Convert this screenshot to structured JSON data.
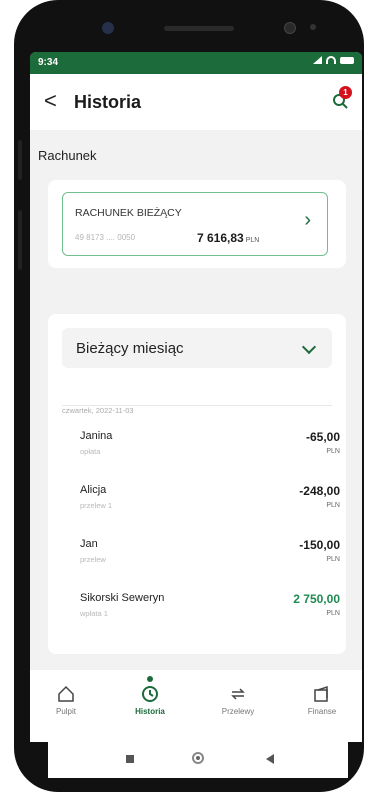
{
  "status": {
    "time": "9:34"
  },
  "header": {
    "title": "Historia",
    "back_label": "<",
    "notification_count": "1"
  },
  "section": {
    "label": "Rachunek"
  },
  "account": {
    "name": "RACHUNEK BIEŻĄCY",
    "number": "49 8173 .... 0050",
    "balance": "7 616,83",
    "currency": "PLN"
  },
  "period": {
    "selected": "Bieżący miesiąc"
  },
  "history": {
    "date": "czwartek, 2022-11-03",
    "transactions": [
      {
        "name": "Janina",
        "type": "opłata",
        "amount": "-65,00",
        "currency": "PLN"
      },
      {
        "name": "Alicja",
        "type": "przelew 1",
        "amount": "-248,00",
        "currency": "PLN"
      },
      {
        "name": "Jan",
        "type": "przelew",
        "amount": "-150,00",
        "currency": "PLN"
      },
      {
        "name": "Sikorski Seweryn",
        "type": "wpłata 1",
        "amount": "2 750,00",
        "currency": "PLN"
      }
    ]
  },
  "tabs": [
    {
      "label": "Pulpit",
      "icon": "home-icon"
    },
    {
      "label": "Historia",
      "icon": "history-icon"
    },
    {
      "label": "Przelewy",
      "icon": "transfer-icon"
    },
    {
      "label": "Finanse",
      "icon": "wallet-icon"
    }
  ],
  "colors": {
    "brand": "#1c6b3a",
    "positive": "#1f8a52",
    "badge": "#d4121e"
  }
}
